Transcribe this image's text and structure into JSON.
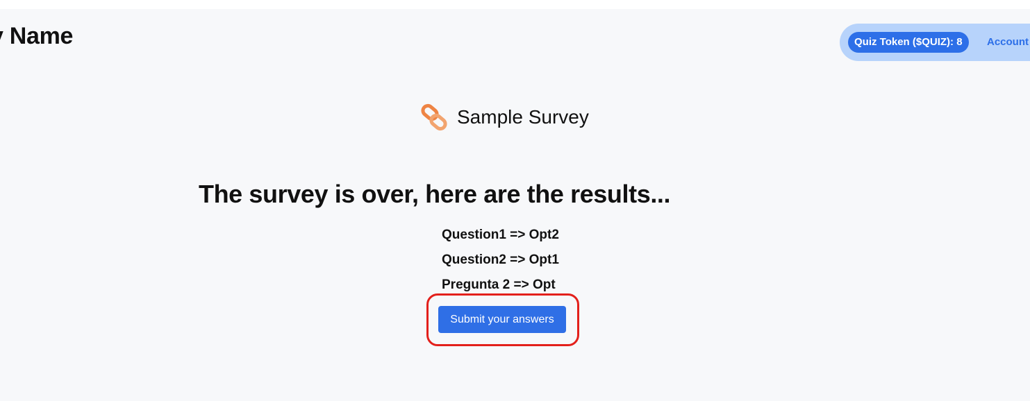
{
  "header": {
    "site_name": "y Name",
    "token_badge": "Quiz Token ($QUIZ): 8",
    "account_link": "Account"
  },
  "survey": {
    "brand_icon": "chain-link-icon",
    "title": "Sample Survey"
  },
  "results": {
    "heading": "The survey is over, here are the results...",
    "items": [
      "Question1 => Opt2",
      "Question2 => Opt1",
      "Pregunta 2 => Opt"
    ]
  },
  "actions": {
    "submit_label": "Submit your answers"
  },
  "colors": {
    "page_background": "#f7f8fa",
    "header_pill": "#b7d3fb",
    "primary_blue": "#2d6fe8",
    "highlight_red": "#e3201b",
    "brand_orange": "#ee8444"
  }
}
